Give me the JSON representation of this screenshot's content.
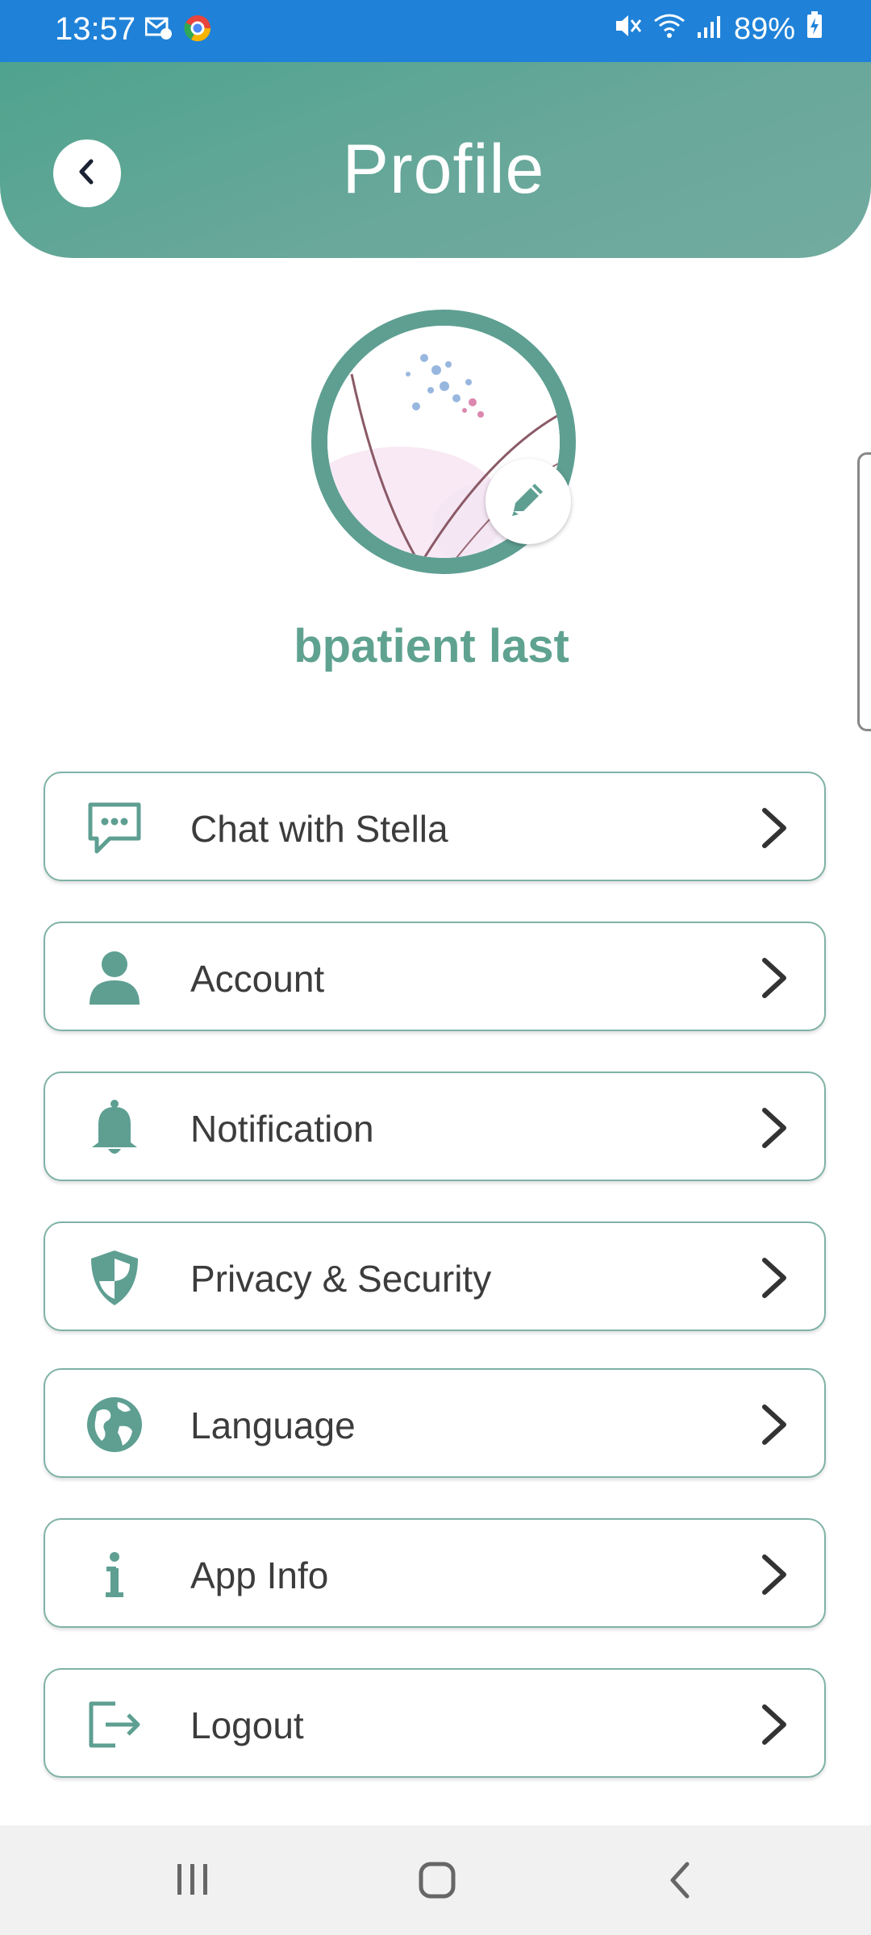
{
  "status_bar": {
    "time": "13:57",
    "battery": "89%",
    "icons": [
      "mail-settings-icon",
      "chrome-icon",
      "mute-icon",
      "wifi-icon",
      "signal-icon",
      "battery-charging-icon"
    ]
  },
  "header": {
    "title": "Profile",
    "back_icon": "chevron-left-icon"
  },
  "profile": {
    "username": "bpatient last",
    "edit_icon": "pencil-icon"
  },
  "menu": {
    "items": [
      {
        "label": "Chat with Stella",
        "icon": "chat-icon"
      },
      {
        "label": "Account",
        "icon": "person-icon"
      },
      {
        "label": "Notification",
        "icon": "bell-icon"
      },
      {
        "label": "Privacy & Security",
        "icon": "shield-icon"
      },
      {
        "label": "Language",
        "icon": "globe-icon"
      },
      {
        "label": "App Info",
        "icon": "info-icon"
      },
      {
        "label": "Logout",
        "icon": "logout-icon"
      }
    ]
  },
  "colors": {
    "accent": "#5e9f92",
    "status_bar": "#1f82d8",
    "text": "#3c3c3c"
  }
}
